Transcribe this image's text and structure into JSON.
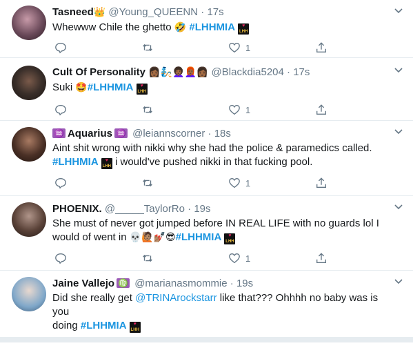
{
  "tweets": [
    {
      "name": "Tasneed",
      "name_emoji": "👑",
      "handle": "@Young_QUEENN",
      "time": "17s",
      "text_parts": [
        "Whewww Chile the ghetto ",
        "🤣",
        " ",
        "#LHHMIA"
      ],
      "likes": "1",
      "avatar_color": "#6b4a5a"
    },
    {
      "name": "Cult Of Personality",
      "name_emoji": "👩🏾🧞👩🏾‍🦱👩🏾‍🦰👩🏾",
      "handle": "@Blackdia5204",
      "time": "17s",
      "text_parts": [
        "Suki ",
        "🤩",
        "#LHHMIA"
      ],
      "likes": "1",
      "avatar_color": "#3a2f2a"
    },
    {
      "name": "Aquarius",
      "name_badge": "♒",
      "handle": "@leiannscorner",
      "time": "18s",
      "line1": "Aint shit wrong with nikki why she had the police & paramedics called.",
      "hashtag": "#LHHMIA",
      "line2_rest": " i would've pushed nikki in that fucking pool.",
      "likes": "1",
      "avatar_color": "#4a3026"
    },
    {
      "name": "PHOENIX.",
      "handle": "@_____TaylorRo",
      "time": "19s",
      "line1": "She must of never got jumped before IN REAL LIFE with no guards lol I",
      "line2_text": "would of went in ",
      "line2_emoji": "💀🙋🏽💅🏽😎",
      "hashtag": "#LHHMIA",
      "likes": "1",
      "avatar_color": "#5a4238"
    },
    {
      "name": "Jaine Vallejo",
      "name_badge": "♍",
      "handle": "@marianasmommie",
      "time": "19s",
      "line1_pre": "Did she really get ",
      "mention": "@TRINArockstarr",
      "line1_post": " like that??? Ohhhh no baby was is you",
      "line2_text": "doing ",
      "hashtag": "#LHHMIA",
      "likes": "",
      "avatar_color": "#7fa7c9"
    }
  ],
  "separator": "·",
  "lhh_logo_text": "LHH",
  "colors": {
    "link": "#1b95e0",
    "muted": "#657786",
    "divider": "#e6ecf0"
  }
}
